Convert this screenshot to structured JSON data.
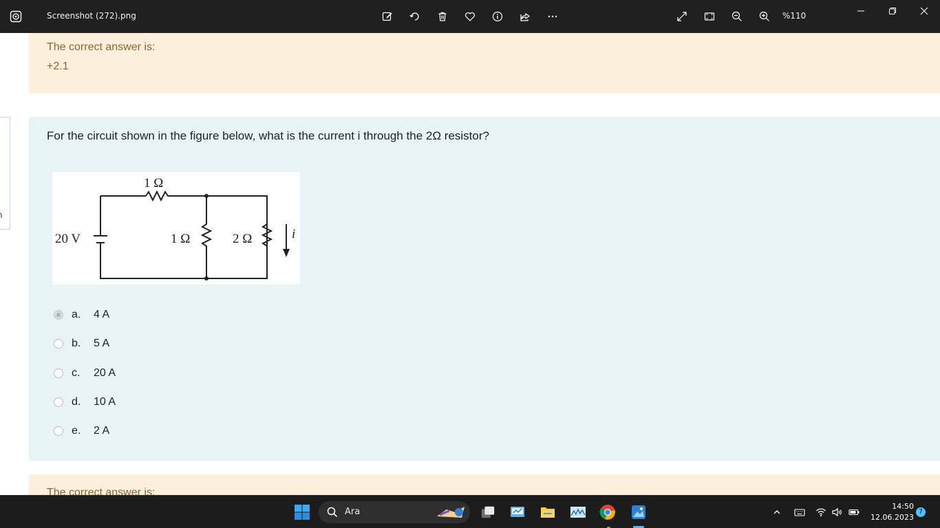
{
  "window": {
    "title": "Screenshot (272).png",
    "zoom_level": "%110"
  },
  "quiz": {
    "prev_answer_label": "The correct answer is:",
    "prev_answer_value": "+2.1",
    "question": "For the circuit shown in the figure below, what is the current i through the 2Ω  resistor?",
    "figure_labels": {
      "source": "20 V",
      "series_resistor": "1 Ω",
      "shunt_resistor_1": "1 Ω",
      "shunt_resistor_2": "2 Ω",
      "current": "i"
    },
    "options": [
      {
        "letter": "a.",
        "text": "4 A",
        "selected": true
      },
      {
        "letter": "b.",
        "text": "5 A",
        "selected": false
      },
      {
        "letter": "c.",
        "text": "20 A",
        "selected": false
      },
      {
        "letter": "d.",
        "text": "10 A",
        "selected": false
      },
      {
        "letter": "e.",
        "text": "2 A",
        "selected": false
      }
    ],
    "next_answer_label": "The correct answer is:"
  },
  "side_tab": {
    "label": "n"
  },
  "taskbar": {
    "search_label": "Ara",
    "time": "14:50",
    "date": "12.06.2023",
    "notification_count": "7"
  },
  "colors": {
    "titlebar_bg": "#202020",
    "answer_bg": "#fcefdc",
    "answer_text": "#8e662e",
    "question_bg": "#e7f3f5",
    "taskbar_bg": "#1c1c1c",
    "accent": "#4cc2ff"
  }
}
